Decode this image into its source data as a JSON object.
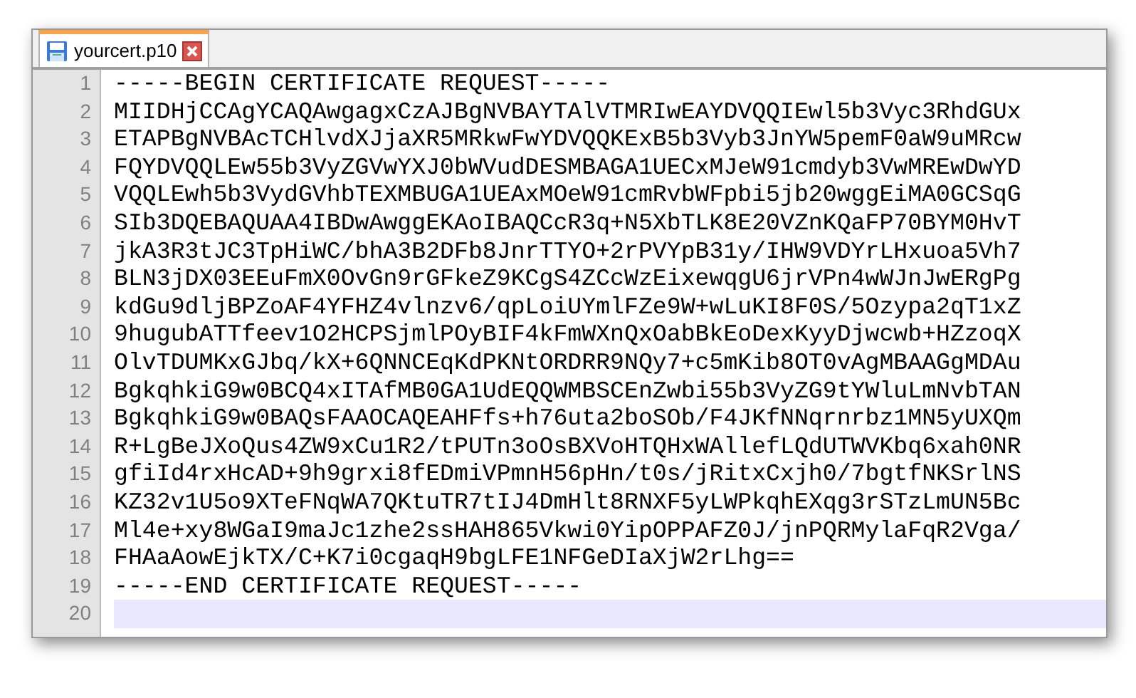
{
  "tabs": [
    {
      "label": "yourcert.p10",
      "selected": true
    }
  ],
  "lines": [
    {
      "number": "1",
      "text": "-----BEGIN CERTIFICATE REQUEST-----",
      "current": false
    },
    {
      "number": "2",
      "text": "MIIDHjCCAgYCAQAwgagxCzAJBgNVBAYTAlVTMRIwEAYDVQQIEwl5b3Vyc3RhdGUx",
      "current": false
    },
    {
      "number": "3",
      "text": "ETAPBgNVBAcTCHlvdXJjaXR5MRkwFwYDVQQKExB5b3Vyb3JnYW5pemF0aW9uMRcw",
      "current": false
    },
    {
      "number": "4",
      "text": "FQYDVQQLEw55b3VyZGVwYXJ0bWVudDESMBAGA1UECxMJeW91cmdyb3VwMREwDwYD",
      "current": false
    },
    {
      "number": "5",
      "text": "VQQLEwh5b3VydGVhbTEXMBUGA1UEAxMOeW91cmRvbWFpbi5jb20wggEiMA0GCSqG",
      "current": false
    },
    {
      "number": "6",
      "text": "SIb3DQEBAQUAA4IBDwAwggEKAoIBAQCcR3q+N5XbTLK8E20VZnKQaFP70BYM0HvT",
      "current": false
    },
    {
      "number": "7",
      "text": "jkA3R3tJC3TpHiWC/bhA3B2DFb8JnrTTYO+2rPVYpB31y/IHW9VDYrLHxuoa5Vh7",
      "current": false
    },
    {
      "number": "8",
      "text": "BLN3jDX03EEuFmX0OvGn9rGFkeZ9KCgS4ZCcWzEixewqgU6jrVPn4wWJnJwERgPg",
      "current": false
    },
    {
      "number": "9",
      "text": "kdGu9dljBPZoAF4YFHZ4vlnzv6/qpLoiUYmlFZe9W+wLuKI8F0S/5Ozypa2qT1xZ",
      "current": false
    },
    {
      "number": "10",
      "text": "9hugubATTfeev1O2HCPSjmlPOyBIF4kFmWXnQxOabBkEoDexKyyDjwcwb+HZzoqX",
      "current": false
    },
    {
      "number": "11",
      "text": "OlvTDUMKxGJbq/kX+6QNNCEqKdPKNtORDRR9NQy7+c5mKib8OT0vAgMBAAGgMDAu",
      "current": false
    },
    {
      "number": "12",
      "text": "BgkqhkiG9w0BCQ4xITAfMB0GA1UdEQQWMBSCEnZwbi55b3VyZG9tYWluLmNvbTAN",
      "current": false
    },
    {
      "number": "13",
      "text": "BgkqhkiG9w0BAQsFAAOCAQEAHFfs+h76uta2boSOb/F4JKfNNqrnrbz1MN5yUXQm",
      "current": false
    },
    {
      "number": "14",
      "text": "R+LgBeJXoQus4ZW9xCu1R2/tPUTn3oOsBXVoHTQHxWAllefLQdUTWVKbq6xah0NR",
      "current": false
    },
    {
      "number": "15",
      "text": "gfiId4rxHcAD+9h9grxi8fEDmiVPmnH56pHn/t0s/jRitxCxjh0/7bgtfNKSrlNS",
      "current": false
    },
    {
      "number": "16",
      "text": "KZ32v1U5o9XTeFNqWA7QKtuTR7tIJ4DmHlt8RNXF5yLWPkqhEXqg3rSTzLmUN5Bc",
      "current": false
    },
    {
      "number": "17",
      "text": "Ml4e+xy8WGaI9maJc1zhe2ssHAH865Vkwi0YipOPPAFZ0J/jnPQRMylaFqR2Vga/",
      "current": false
    },
    {
      "number": "18",
      "text": "FHAaAowEjkTX/C+K7i0cgaqH9bgLFE1NFGeDIaXjW2rLhg==",
      "current": false
    },
    {
      "number": "19",
      "text": "-----END CERTIFICATE REQUEST-----",
      "current": false
    },
    {
      "number": "20",
      "current": true
    }
  ]
}
